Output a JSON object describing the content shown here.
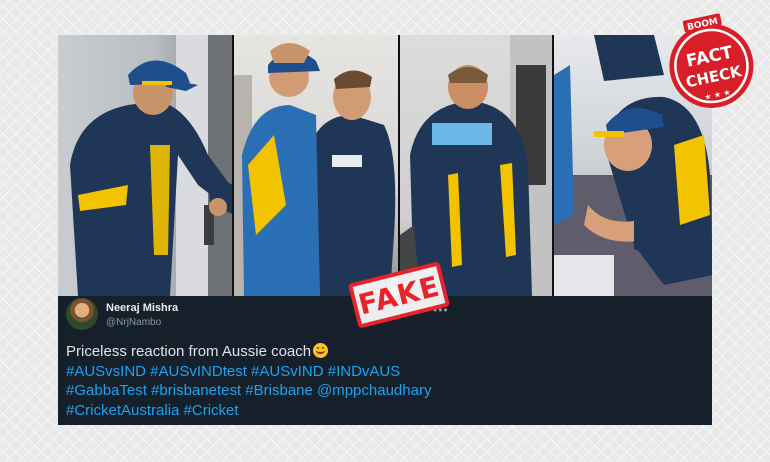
{
  "tweet": {
    "author_name": "Neeraj Mishra",
    "author_handle": "@NrjNambo",
    "text": "Priceless reaction from Aussie coach",
    "hashtag_lines": [
      "#AUSvsIND #AUSvINDtest #AUSvIND #INDvAUS",
      "#GabbaTest #brisbanetest #Brisbane @mppchaudhary",
      "#CricketAustralia #Cricket"
    ],
    "more_icon": "more-options-icon",
    "emoji": "smiling-face-emoji"
  },
  "overlay": {
    "stamp_text": "FAKE",
    "stamp_color": "#e8232a"
  },
  "badge": {
    "brand": "BOOM",
    "line1": "FACT",
    "line2": "CHECK",
    "color": "#d81f27"
  },
  "colors": {
    "tweet_background": "#15202b",
    "link": "#1da1f2",
    "jersey": "#1f3656",
    "jersey_accent": "#f4c300"
  }
}
